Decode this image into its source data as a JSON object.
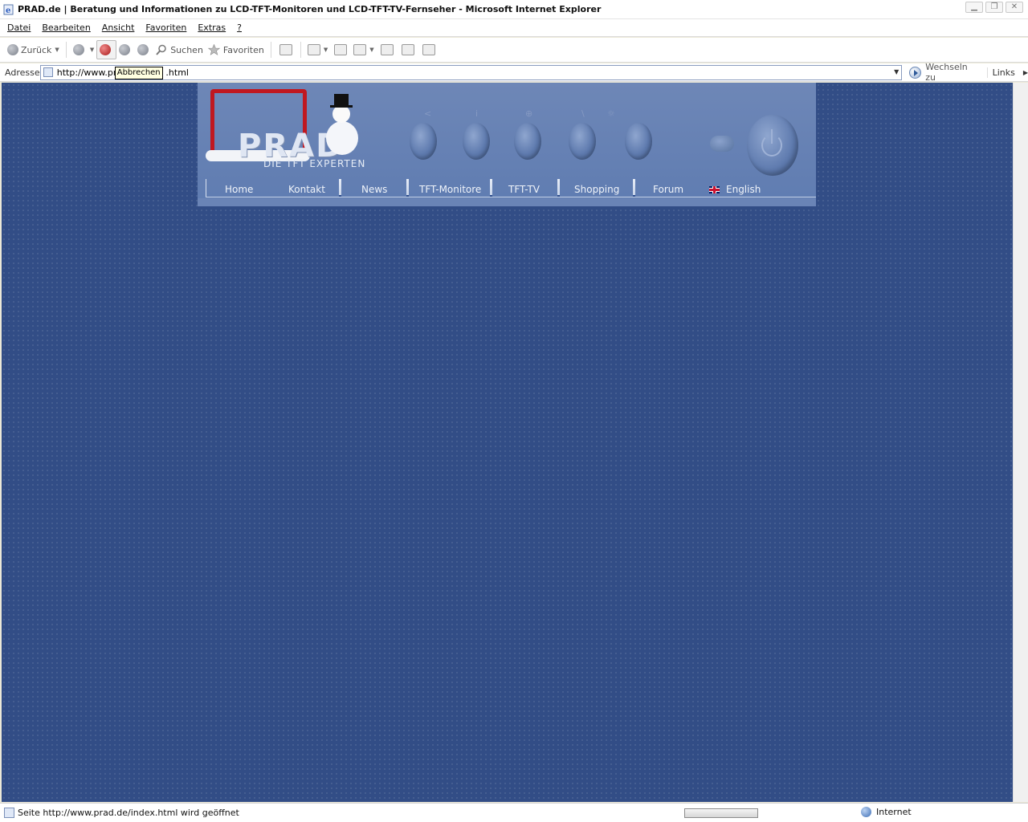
{
  "window": {
    "title": "PRAD.de  | Beratung und Informationen zu LCD-TFT-Monitoren und LCD-TFT-TV-Fernseher - Microsoft Internet Explorer",
    "controls": [
      "▁",
      "❐",
      "✕"
    ]
  },
  "menu": [
    "Datei",
    "Bearbeiten",
    "Ansicht",
    "Favoriten",
    "Extras",
    "?"
  ],
  "toolbar": {
    "back_label": "Zurück",
    "search_label": "Suchen",
    "favorites_label": "Favoriten"
  },
  "address": {
    "label": "Adresse",
    "url_start": "http://www.pr",
    "url_end": ".html",
    "tooltip": "Abbrechen",
    "go_label": "Wechseln zu",
    "links_label": "Links"
  },
  "site": {
    "logo_text": "PRAD",
    "slogan": "DIE TFT EXPERTEN",
    "knob_marks": [
      "<",
      "i",
      "⊕",
      "\\",
      "☼"
    ],
    "nav": [
      {
        "label": "Home"
      },
      {
        "label": "Kontakt"
      },
      {
        "label": "News"
      },
      {
        "label": "TFT-Monitore"
      },
      {
        "label": "TFT-TV"
      },
      {
        "label": "Shopping"
      },
      {
        "label": "Forum"
      },
      {
        "label": "English"
      }
    ]
  },
  "status": {
    "text": "Seite http://www.prad.de/index.html wird geöffnet",
    "zone": "Internet",
    "progress": 0.0
  },
  "colors": {
    "page_background": "#324d86",
    "header_background": "#6e87b7",
    "logo_red": "#c01820"
  }
}
